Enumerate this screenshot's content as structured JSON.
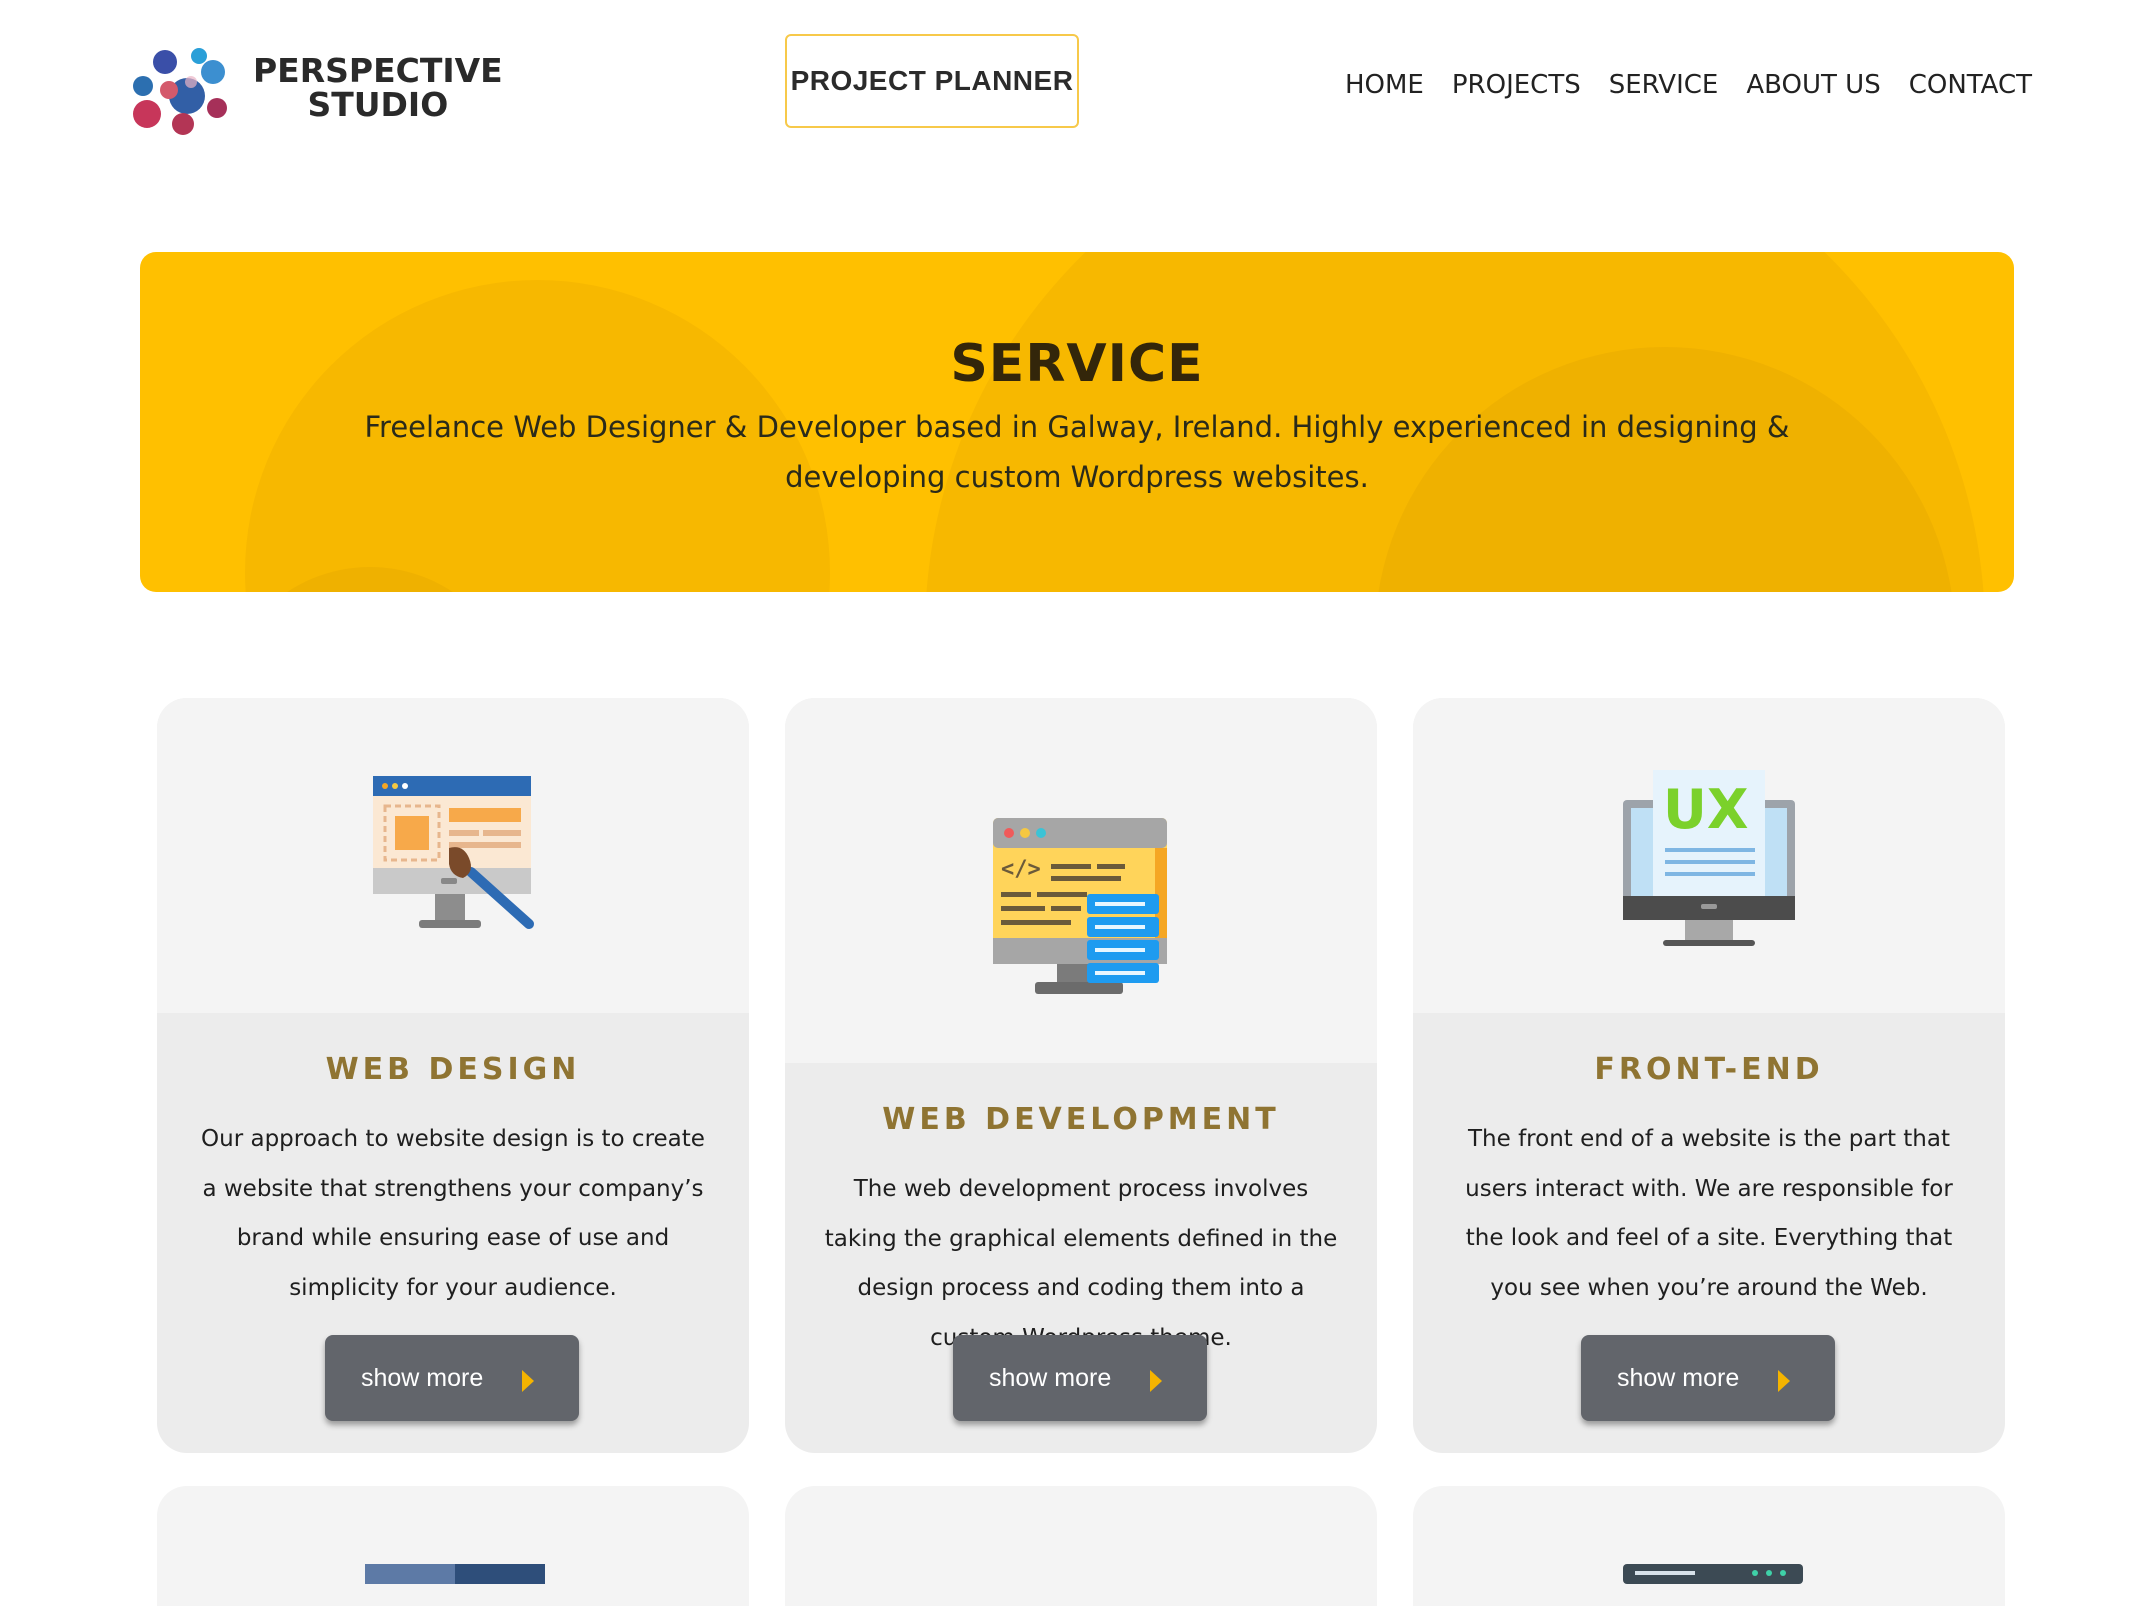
{
  "header": {
    "logo_line1": "PERSPECTIVE",
    "logo_line2": "STUDIO",
    "planner_label": "PROJECT PLANNER",
    "nav": [
      "HOME",
      "PROJECTS",
      "SERVICE",
      "ABOUT US",
      "CONTACT"
    ]
  },
  "hero": {
    "title": "SERVICE",
    "subtitle": "Freelance Web Designer & Developer based in Galway, Ireland. Highly experienced in designing & developing custom Wordpress websites."
  },
  "cards": [
    {
      "title": "WEB DESIGN",
      "icon": "web-design-icon",
      "description": "Our approach to website design is to create a website that strengthens your company’s brand while ensuring ease of use and simplicity for your audience.",
      "button": "show more"
    },
    {
      "title": "WEB DEVELOPMENT",
      "icon": "web-development-icon",
      "description": "The web development process involves taking the graphical elements defined in the design process and coding them into a custom Wordpress theme.",
      "button": "show more"
    },
    {
      "title": "FRONT-END",
      "icon": "ux-monitor-icon",
      "description": "The front end of a website is the part that users interact with. We are responsible for the look and feel of a site. Everything that you see when you’re around the Web.",
      "button": "show more"
    }
  ],
  "colors": {
    "accent_yellow": "#ffc000",
    "title_gold": "#8f7432",
    "button_gray": "#62656b",
    "arrow_yellow": "#f5b400"
  }
}
